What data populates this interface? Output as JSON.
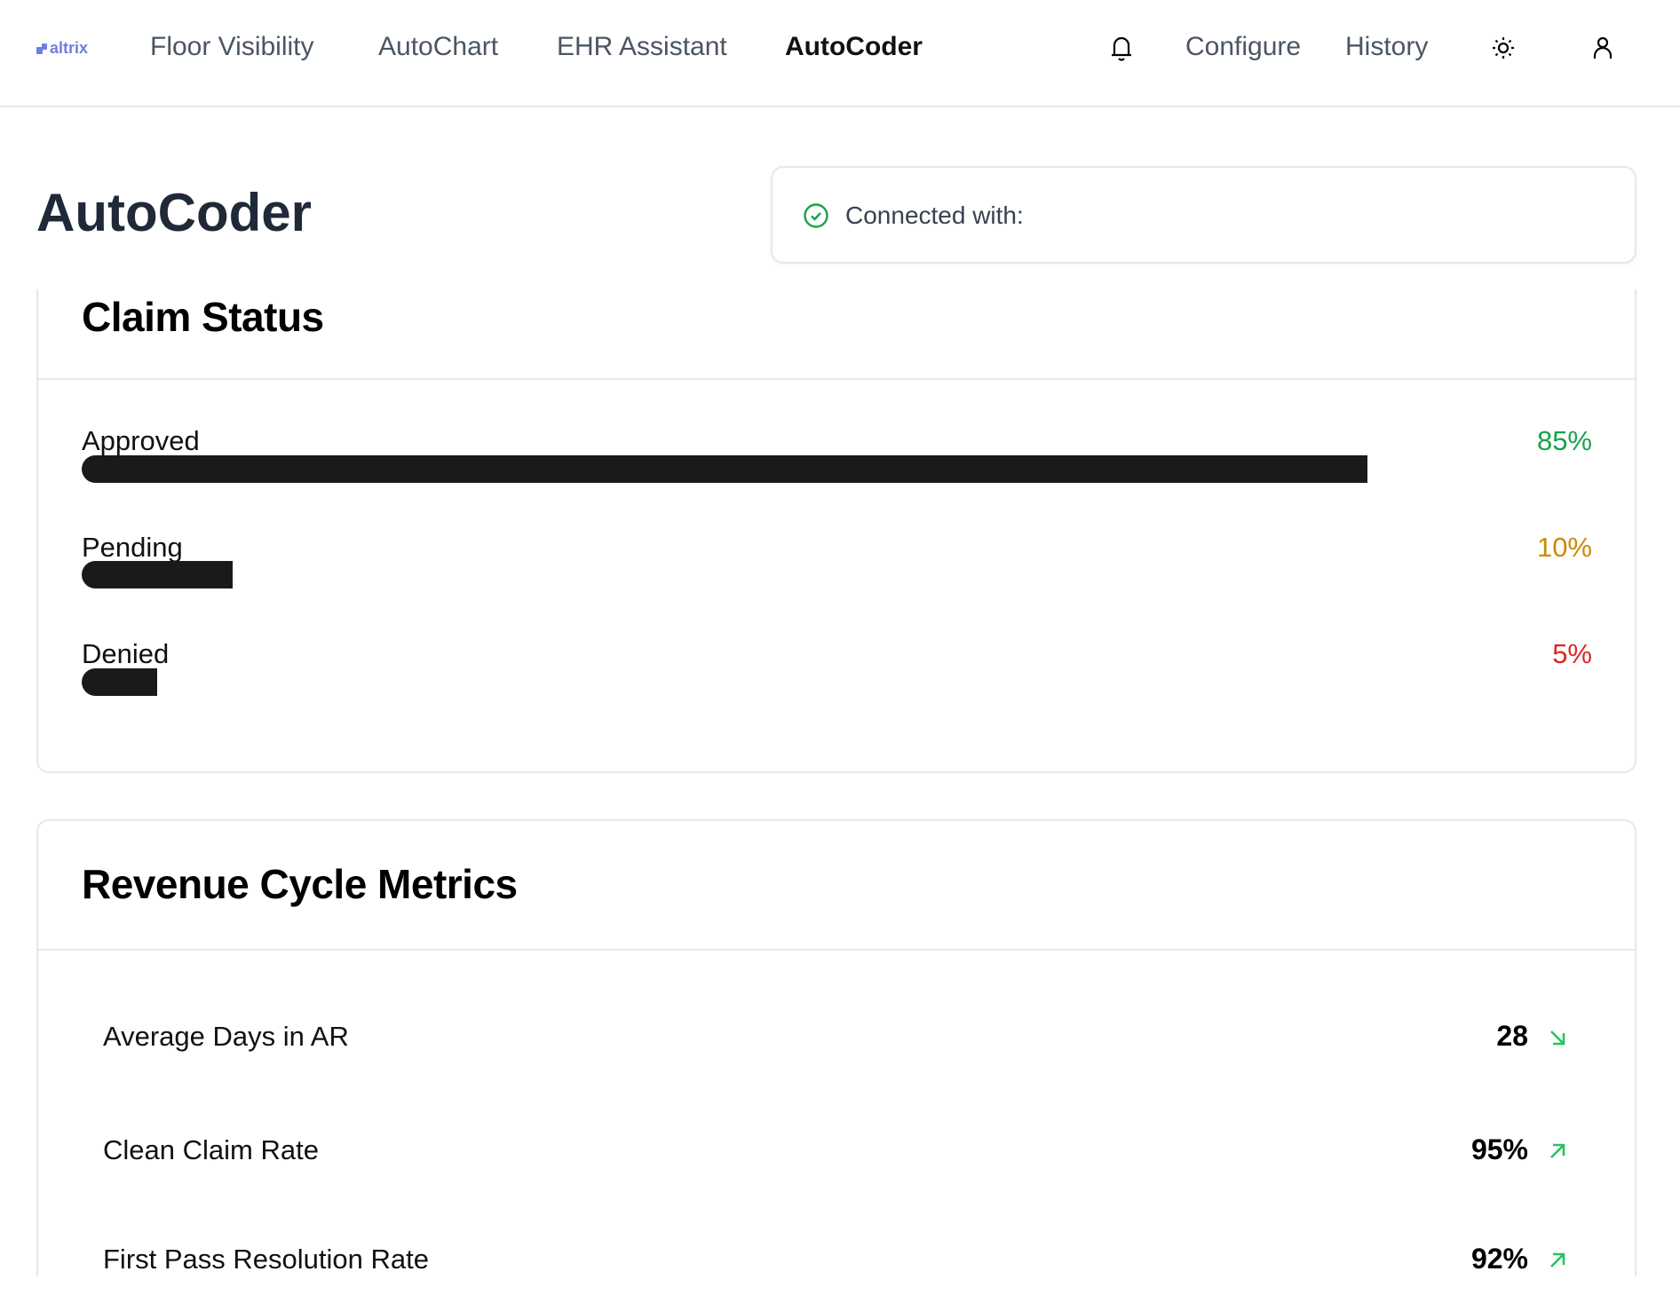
{
  "header": {
    "logo_text": "altrix",
    "nav": [
      "Floor Visibility",
      "AutoChart",
      "EHR Assistant",
      "AutoCoder"
    ],
    "active_nav": "AutoCoder",
    "right_links": [
      "Configure",
      "History"
    ],
    "icons": [
      "bell-icon",
      "sun-icon",
      "user-icon"
    ]
  },
  "page": {
    "title": "AutoCoder",
    "connection_label": "Connected with:"
  },
  "claim_status": {
    "title": "Claim Status",
    "items": [
      {
        "label": "Approved",
        "pct_text": "85%",
        "value": 85,
        "color": "#16a34a"
      },
      {
        "label": "Pending",
        "pct_text": "10%",
        "value": 10,
        "color": "#ca8a04"
      },
      {
        "label": "Denied",
        "pct_text": "5%",
        "value": 5,
        "color": "#dc2626"
      }
    ]
  },
  "revenue": {
    "title": "Revenue Cycle Metrics",
    "metrics": [
      {
        "label": "Average Days in AR",
        "value": "28",
        "trend": "down"
      },
      {
        "label": "Clean Claim Rate",
        "value": "95%",
        "trend": "up"
      },
      {
        "label": "First Pass Resolution Rate",
        "value": "92%",
        "trend": "up"
      }
    ],
    "trend_color": "#22c55e"
  }
}
